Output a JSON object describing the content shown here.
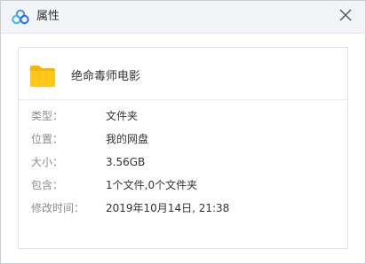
{
  "window": {
    "title": "属性",
    "close_symbol": "✕",
    "accent_color": "#4a90e2",
    "folder_color": "#ffc61a"
  },
  "file": {
    "name": "绝命毒师电影",
    "icon": "folder-icon"
  },
  "properties": [
    {
      "label": "类型：",
      "value": "文件夹"
    },
    {
      "label": "位置：",
      "value": "我的网盘"
    },
    {
      "label": "大小：",
      "value": "3.56GB"
    },
    {
      "label": "包含：",
      "value": "1个文件,0个文件夹"
    },
    {
      "label": "修改时间：",
      "value": "2019年10月14日, 21:38"
    }
  ]
}
